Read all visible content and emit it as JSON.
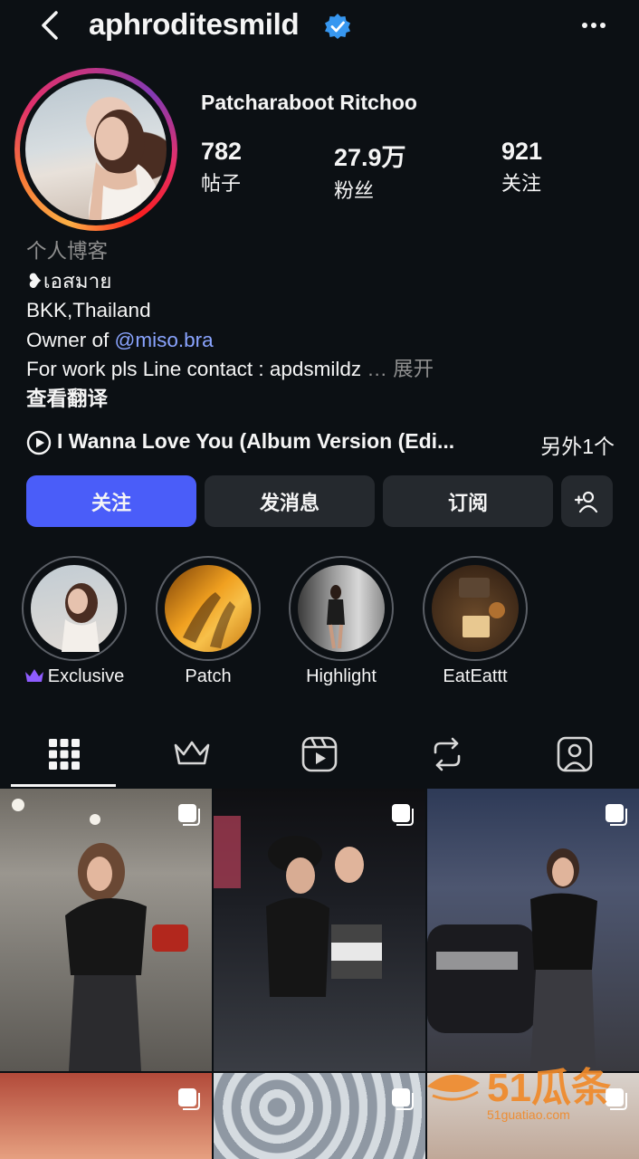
{
  "header": {
    "username": "aphroditesmild",
    "back_icon": "chevron-left-icon",
    "verified_icon": "verified-badge-icon",
    "more_icon": "more-horizontal-icon"
  },
  "profile": {
    "full_name": "Patcharaboot Ritchoo",
    "stats": [
      {
        "value": "782",
        "label": "帖子"
      },
      {
        "value": "27.9万",
        "label": "粉丝"
      },
      {
        "value": "921",
        "label": "关注"
      }
    ]
  },
  "bio": {
    "category": "个人博客",
    "line1": "❥เอสมาย",
    "line2": "BKK,Thailand",
    "line3_prefix": "Owner of ",
    "line3_mention": "@miso.bra",
    "line4": "For work pls Line contact : apdsmildz",
    "expand": "展开",
    "translate": "查看翻译"
  },
  "music": {
    "title": "I Wanna Love You (Album Version (Edi...",
    "other": "另外1个",
    "play_icon": "play-circle-icon"
  },
  "buttons": {
    "follow": "关注",
    "message": "发消息",
    "subscribe": "订阅",
    "add_user_icon": "add-user-icon"
  },
  "highlights": [
    {
      "label": "Exclusive",
      "badge_icon": "crown-icon"
    },
    {
      "label": "Patch"
    },
    {
      "label": "Highlight"
    },
    {
      "label": "EatEattt"
    }
  ],
  "tabs": [
    {
      "name": "grid",
      "icon": "grid-icon",
      "active": true
    },
    {
      "name": "subscriber",
      "icon": "crown-outline-icon",
      "active": false
    },
    {
      "name": "reels",
      "icon": "reels-icon",
      "active": false
    },
    {
      "name": "reposts",
      "icon": "repost-icon",
      "active": false
    },
    {
      "name": "tagged",
      "icon": "tagged-user-icon",
      "active": false
    }
  ],
  "colors": {
    "background": "#0c1014",
    "primary_button": "#4a5df9",
    "secondary_button": "#25292e",
    "mention": "#8aa4ff",
    "muted": "#8e8e8e",
    "exclusive_crown": "#8e5cff",
    "verified": "#3797f0"
  },
  "watermark": {
    "text": "51瓜条",
    "url": "51guatiao.com"
  }
}
